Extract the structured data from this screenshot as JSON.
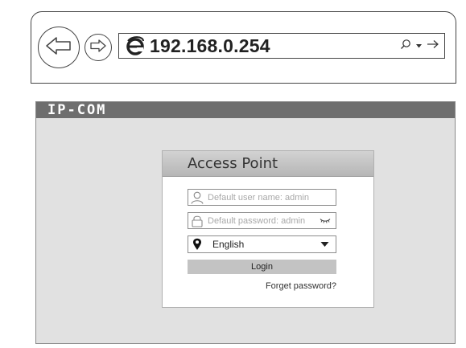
{
  "browser": {
    "address_url": "192.168.0.254",
    "icons": {
      "back": "back-arrow-icon",
      "forward": "forward-arrow-icon",
      "browser": "internet-explorer-icon",
      "search": "search-icon",
      "dropdown": "chevron-down-icon",
      "go": "go-arrow-icon"
    }
  },
  "page": {
    "brand_logo": "IP-COM",
    "background_color": "#e1e1e1",
    "topbar_color": "#6e6e6e"
  },
  "login": {
    "title": "Access Point",
    "username_placeholder": "Default user name: admin",
    "password_placeholder": "Default password: admin",
    "language_selected": "English",
    "login_button": "Login",
    "forget_password": "Forget password?",
    "icons": {
      "user": "user-icon",
      "lock": "lock-icon",
      "eye": "hidden-password-icon",
      "location": "location-pin-icon",
      "select_arrow": "caret-down-icon"
    }
  }
}
